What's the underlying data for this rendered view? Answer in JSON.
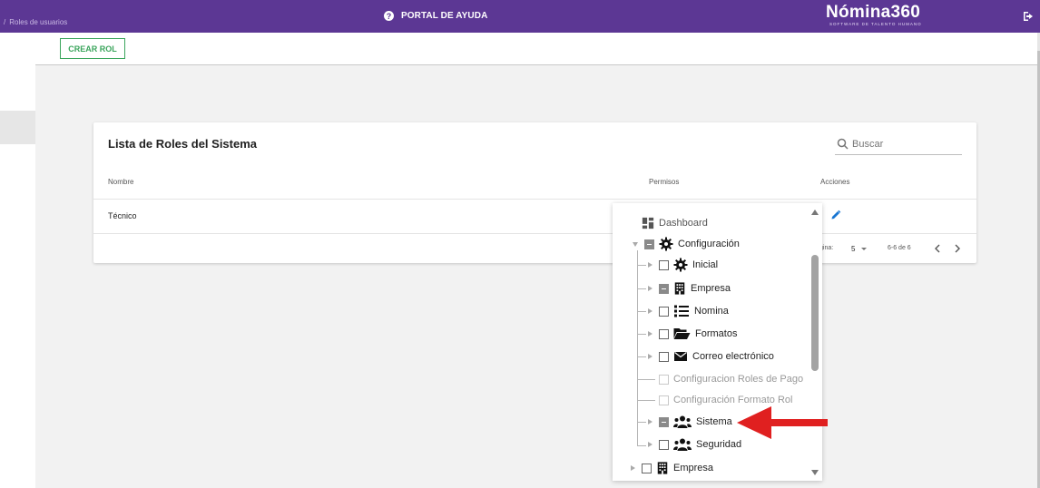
{
  "breadcrumb": {
    "separator": "/",
    "current": "Roles de usuarios"
  },
  "header": {
    "help_label": "PORTAL DE AYUDA",
    "help_icon": "question-circle-icon",
    "logo_name": "Nómina360",
    "logo_tagline": "SOFTWARE DE TALENTO HUMANO",
    "logout_icon": "logout-icon"
  },
  "toolbar": {
    "create_label": "CREAR ROL"
  },
  "card": {
    "title": "Lista de Roles del Sistema",
    "search_placeholder": "Buscar",
    "columns": {
      "name": "Nombre",
      "permissions": "Permisos",
      "actions": "Acciones"
    },
    "rows": [
      {
        "name": "Técnico"
      }
    ],
    "pagination": {
      "label": "gina:",
      "page_size": "5",
      "range": "6-6 de 6"
    }
  },
  "tree": {
    "items": [
      {
        "label": "Dashboard",
        "icon": "dashboard-icon",
        "state": "none"
      },
      {
        "label": "Configuración",
        "icon": "gear-icon",
        "state": "indeterminate",
        "expanded": true
      },
      {
        "label": "Inicial",
        "icon": "gear-icon",
        "state": "unchecked"
      },
      {
        "label": "Empresa",
        "icon": "building-icon",
        "state": "indeterminate"
      },
      {
        "label": "Nomina",
        "icon": "list-icon",
        "state": "unchecked"
      },
      {
        "label": "Formatos",
        "icon": "folder-open-icon",
        "state": "unchecked"
      },
      {
        "label": "Correo electrónico",
        "icon": "envelope-icon",
        "state": "unchecked"
      },
      {
        "label": "Configuracion Roles de Pago",
        "state": "disabled"
      },
      {
        "label": "Configuración Formato Rol",
        "state": "disabled"
      },
      {
        "label": "Sistema",
        "icon": "users-icon",
        "state": "indeterminate"
      },
      {
        "label": "Seguridad",
        "icon": "users-icon",
        "state": "unchecked"
      },
      {
        "label": "Empresa",
        "icon": "building-icon",
        "state": "unchecked"
      }
    ]
  },
  "colors": {
    "header_bg": "#5c3794",
    "create_button": "#3ba55c",
    "edit_icon": "#1976d2",
    "annotation_arrow": "#e02020"
  }
}
